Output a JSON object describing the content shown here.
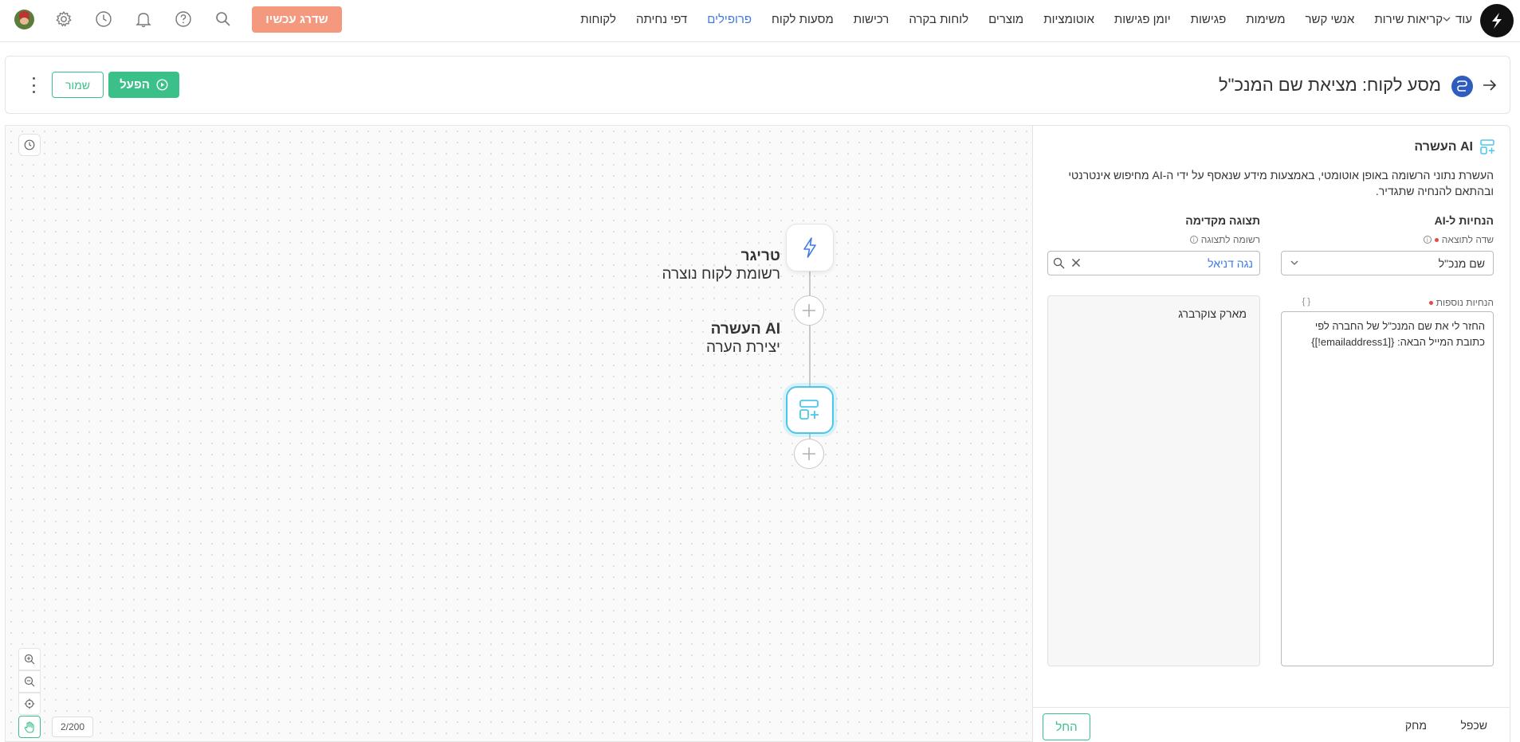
{
  "nav": {
    "items": [
      {
        "label": "לקוחות",
        "active": false
      },
      {
        "label": "דפי נחיתה",
        "active": false
      },
      {
        "label": "פרופילים",
        "active": true
      },
      {
        "label": "מסעות לקוח",
        "active": false
      },
      {
        "label": "רכישות",
        "active": false
      },
      {
        "label": "לוחות בקרה",
        "active": false
      },
      {
        "label": "מוצרים",
        "active": false
      },
      {
        "label": "אוטומציות",
        "active": false
      },
      {
        "label": "יומן פגישות",
        "active": false
      },
      {
        "label": "פגישות",
        "active": false
      },
      {
        "label": "משימות",
        "active": false
      },
      {
        "label": "אנשי קשר",
        "active": false
      },
      {
        "label": "קריאות שירות",
        "active": false
      }
    ],
    "more_label": "עוד",
    "upgrade_label": "שדרג עכשיו",
    "icons": [
      "search-icon",
      "help-icon",
      "bell-icon",
      "clock-icon",
      "gear-icon",
      "avatar"
    ]
  },
  "header": {
    "title": "מסע לקוח: מציאת שם המנכ\"ל",
    "activate_label": "הפעל",
    "save_label": "שמור"
  },
  "canvas": {
    "counter": "2/200",
    "trigger": {
      "title": "טריגר",
      "subtitle": "רשומת לקוח נוצרה"
    },
    "ai_node": {
      "title": "AI העשרה",
      "subtitle": "יצירת הערה"
    }
  },
  "panel": {
    "title": "AI העשרה",
    "description": "העשרת נתוני הרשומה באופן אוטומטי, באמצעות מידע שנאסף על ידי ה-AI מחיפוש אינטרנטי ובהתאם להנחיה שתגדיר.",
    "instructions_heading": "הנחיות ל-AI",
    "preview_heading": "תצוגה מקדימה",
    "result_field_label": "שדה לתוצאה",
    "result_field_value": "שם מנכ\"ל",
    "preview_record_label": "רשומה לתצוגה",
    "preview_record_value": "נגה דניאל",
    "extra_instructions_label": "הנחיות נוספות",
    "braces": "{ }",
    "extra_instructions_text": "החזר לי את שם המנכ\"ל של החברה לפי כתובת המייל הבאה: {[emailaddress1!]}",
    "preview_result": "מארק צוקרברג",
    "footer": {
      "duplicate": "שכפל",
      "delete": "מחק",
      "apply": "החל"
    }
  },
  "colors": {
    "accent_green": "#3cc08a",
    "upgrade_orange": "#f4987e",
    "nav_active_blue": "#3d7be0",
    "ai_node_cyan": "#49c7ef"
  }
}
